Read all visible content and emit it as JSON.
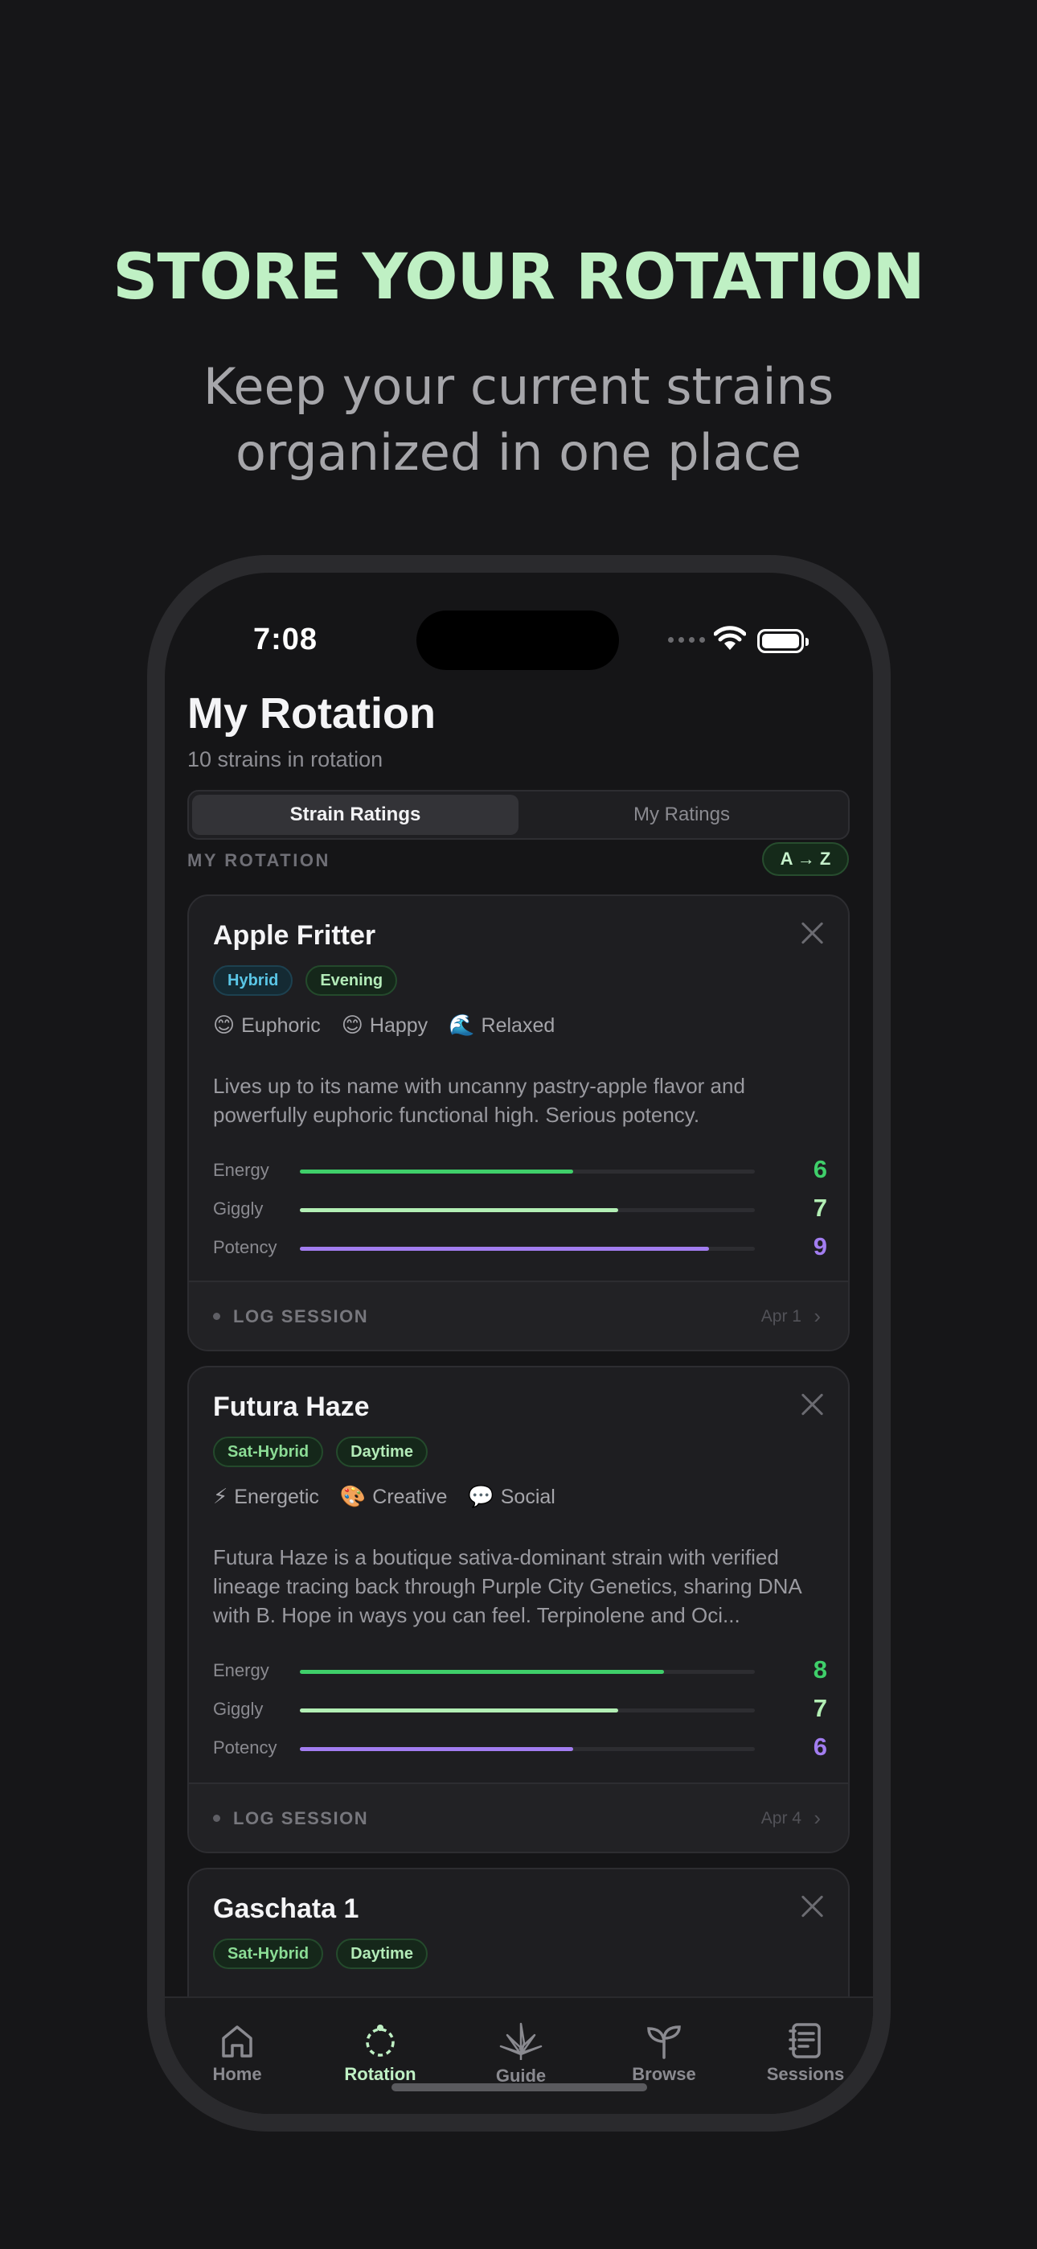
{
  "hero": {
    "title": "STORE YOUR ROTATION",
    "subtitle_line1": "Keep your current strains",
    "subtitle_line2": "organized in one place"
  },
  "status_bar": {
    "time": "7:08"
  },
  "header": {
    "title": "My Rotation",
    "count": "10 strains in rotation"
  },
  "segmented": {
    "options": [
      "Strain Ratings",
      "My Ratings"
    ],
    "selected": "Strain Ratings"
  },
  "section": {
    "label": "MY ROTATION",
    "sort": "A → Z"
  },
  "cards": [
    {
      "name": "Apple Fritter",
      "tags": [
        "Hybrid",
        "Evening"
      ],
      "effects": [
        {
          "emoji": "😊",
          "label": "Euphoric"
        },
        {
          "emoji": "😊",
          "label": "Happy"
        },
        {
          "emoji": "🌊",
          "label": "Relaxed"
        }
      ],
      "description": "Lives up to its name with uncanny pastry-apple flavor and powerfully euphoric functional high. Serious potency.",
      "ratings": [
        {
          "label": "Energy",
          "value": "6",
          "fraction": 0.6
        },
        {
          "label": "Giggly",
          "value": "7",
          "fraction": 0.7
        },
        {
          "label": "Potency",
          "value": "9",
          "fraction": 0.9
        }
      ],
      "log_label": "LOG SESSION",
      "log_date": "Apr 1"
    },
    {
      "name": "Futura Haze",
      "tags": [
        "Sat-Hybrid",
        "Daytime"
      ],
      "effects": [
        {
          "emoji": "⚡",
          "label": "Energetic"
        },
        {
          "emoji": "🎨",
          "label": "Creative"
        },
        {
          "emoji": "💬",
          "label": "Social"
        }
      ],
      "description": "Futura Haze is a boutique sativa-dominant strain with verified lineage tracing back through Purple City Genetics, sharing DNA with B. Hope in ways you can feel. Terpinolene and Oci...",
      "ratings": [
        {
          "label": "Energy",
          "value": "8",
          "fraction": 0.8
        },
        {
          "label": "Giggly",
          "value": "7",
          "fraction": 0.7
        },
        {
          "label": "Potency",
          "value": "6",
          "fraction": 0.6
        }
      ],
      "log_label": "LOG SESSION",
      "log_date": "Apr 4"
    },
    {
      "name": "Gaschata 1",
      "tags": [
        "Sat-Hybrid",
        "Daytime"
      ]
    }
  ],
  "tabbar": {
    "items": [
      {
        "label": "Home",
        "icon": "home-icon"
      },
      {
        "label": "Rotation",
        "icon": "rotation-icon"
      },
      {
        "label": "Guide",
        "icon": "leaf-icon"
      },
      {
        "label": "Browse",
        "icon": "sprout-icon"
      },
      {
        "label": "Sessions",
        "icon": "journal-icon"
      }
    ],
    "active": "Rotation"
  },
  "colors": {
    "accent": "#bff0c4",
    "energy": "#3fcf6a",
    "giggly": "#b3efb5",
    "potency": "#a27df0",
    "background": "#161618"
  }
}
